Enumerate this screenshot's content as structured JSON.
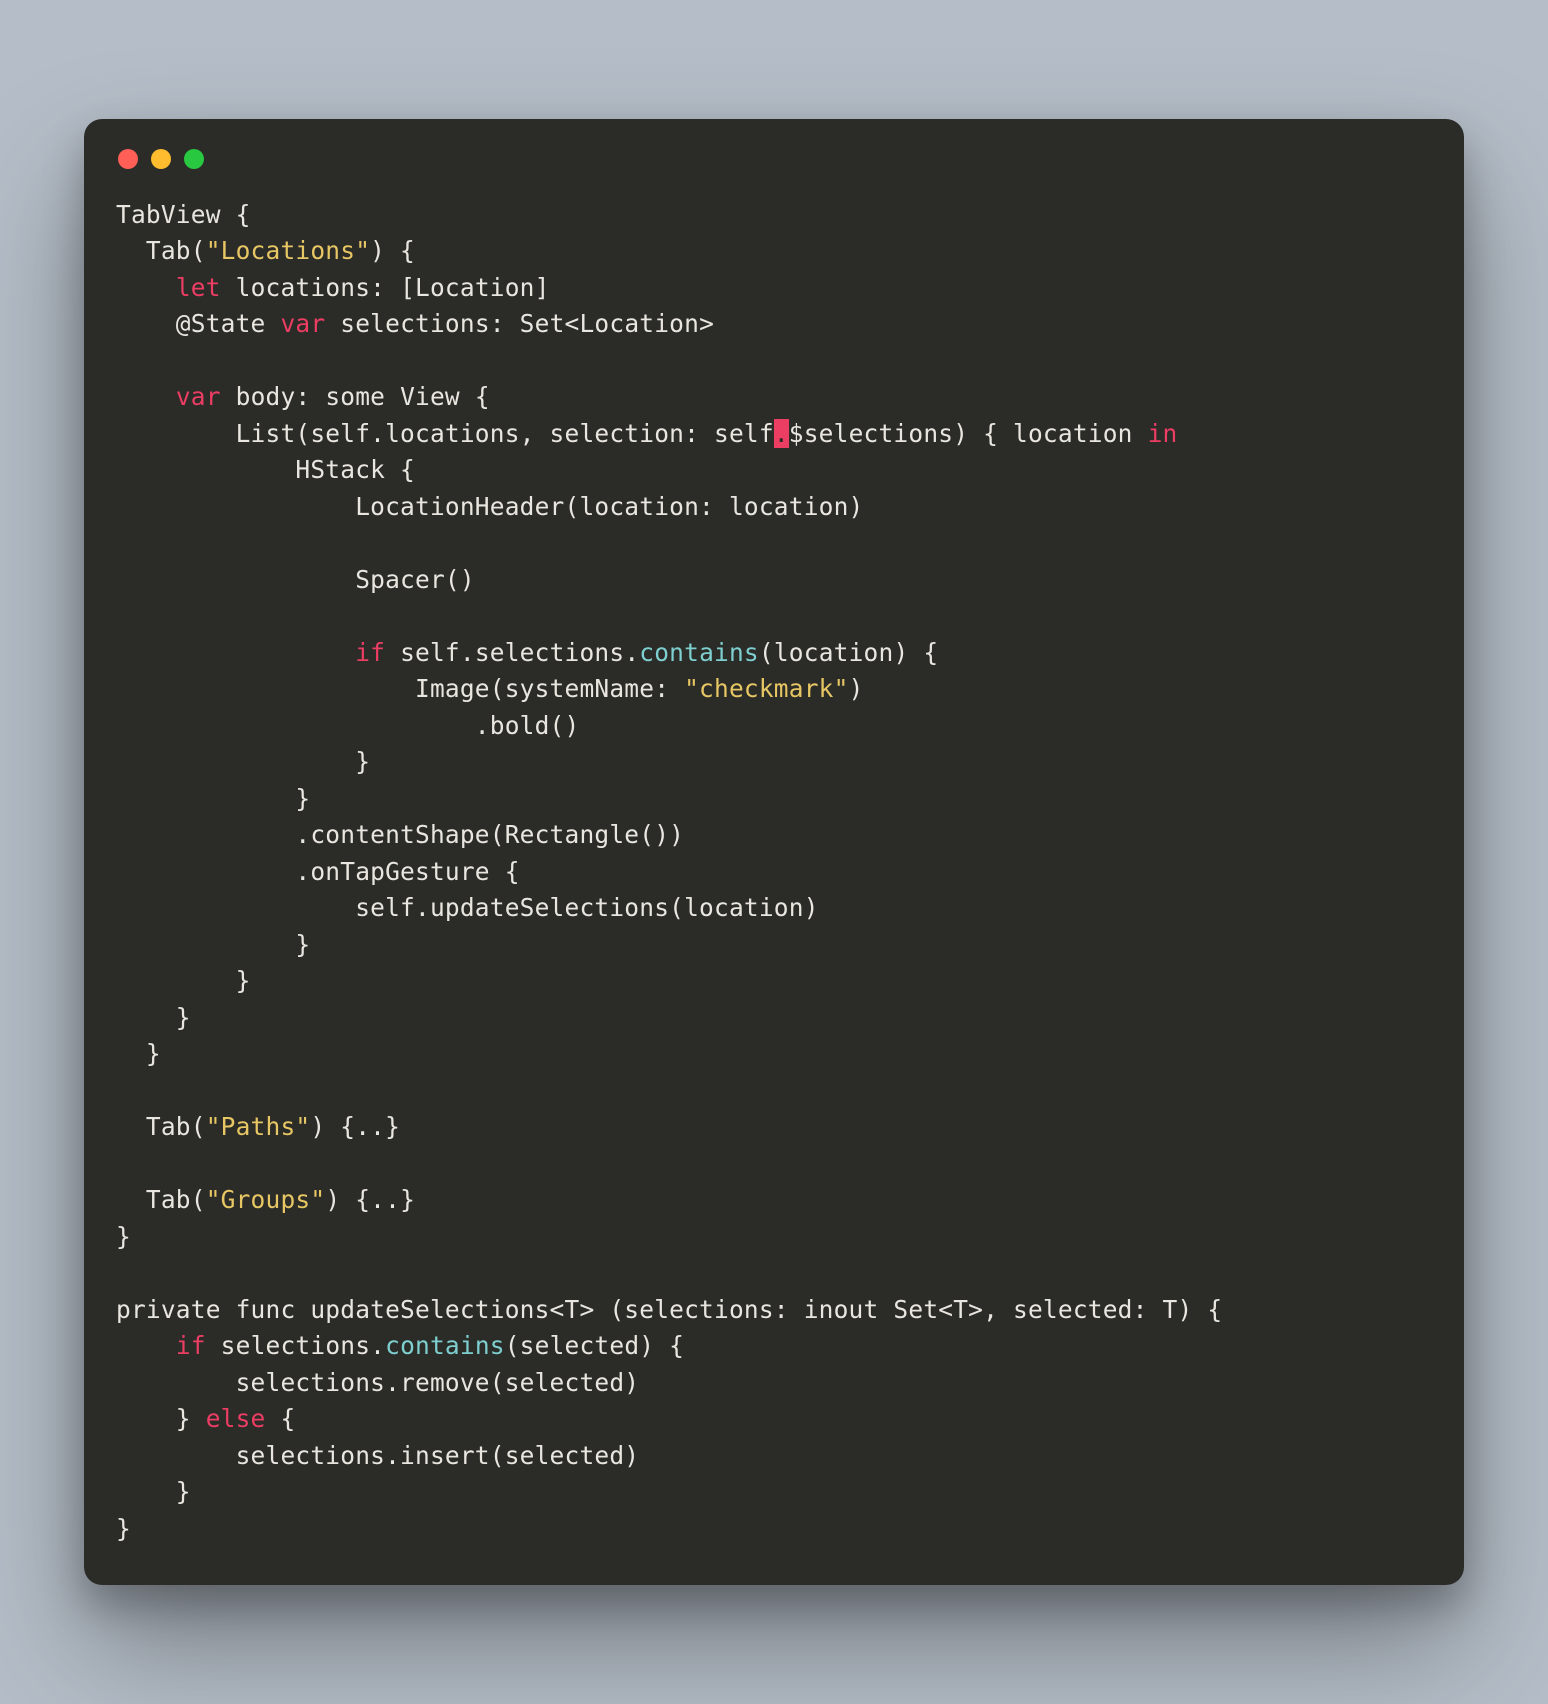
{
  "code": {
    "l1a": "TabView {",
    "l2a": "  Tab(",
    "l2b": "\"Locations\"",
    "l2c": ") {",
    "l3a": "    ",
    "l3b": "let",
    "l3c": " locations: [Location]",
    "l4a": "    @State ",
    "l4b": "var",
    "l4c": " selections: Set<Location>",
    "l5": "",
    "l6a": "    ",
    "l6b": "var",
    "l6c": " body: some View {",
    "l7a": "        List(self.locations, selection: self",
    "l7b": ".",
    "l7c": "$selections) { location ",
    "l7d": "in",
    "l8a": "            HStack {",
    "l9a": "                LocationHeader(location: location)",
    "l10": "",
    "l11a": "                Spacer()",
    "l12": "",
    "l13a": "                ",
    "l13b": "if",
    "l13c": " self.selections.",
    "l13d": "contains",
    "l13e": "(location) {",
    "l14a": "                    Image(systemName: ",
    "l14b": "\"checkmark\"",
    "l14c": ")",
    "l15a": "                        .bold()",
    "l16a": "                }",
    "l17a": "            }",
    "l18a": "            .contentShape(Rectangle())",
    "l19a": "            .onTapGesture {",
    "l20a": "                self.updateSelections(location)",
    "l21a": "            }",
    "l22a": "        }",
    "l23a": "    }",
    "l24a": "  }",
    "l25": "",
    "l26a": "  Tab(",
    "l26b": "\"Paths\"",
    "l26c": ") {..}",
    "l27": "",
    "l28a": "  Tab(",
    "l28b": "\"Groups\"",
    "l28c": ") {..}",
    "l29a": "}",
    "l30": "",
    "l31a": "private func updateSelections<T> (selections: inout Set<T>, selected: T) {",
    "l32a": "    ",
    "l32b": "if",
    "l32c": " selections.",
    "l32d": "contains",
    "l32e": "(selected) {",
    "l33a": "        selections.remove(selected)",
    "l34a": "    } ",
    "l34b": "else",
    "l34c": " {",
    "l35a": "        selections.insert(selected)",
    "l36a": "    }",
    "l37a": "}"
  }
}
